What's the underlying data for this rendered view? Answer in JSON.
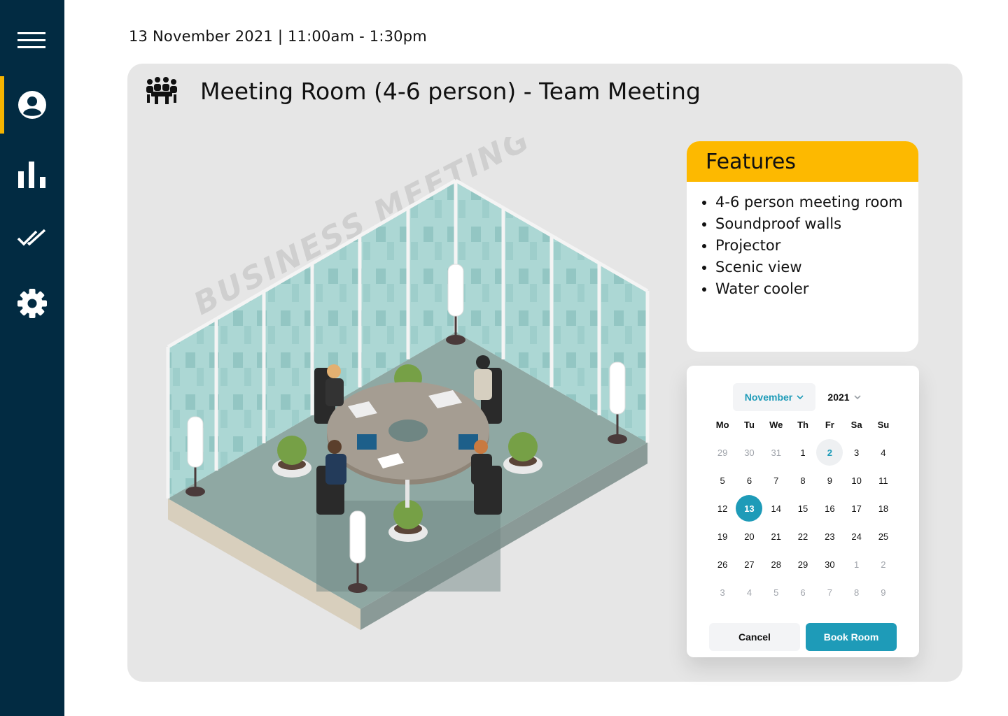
{
  "header": {
    "datetime": "13 November 2021 | 11:00am - 1:30pm"
  },
  "sidebar": {
    "items": [
      {
        "icon": "menu-icon"
      },
      {
        "icon": "user-circle-icon",
        "active": true
      },
      {
        "icon": "bar-chart-icon"
      },
      {
        "icon": "double-check-icon"
      },
      {
        "icon": "gear-icon"
      }
    ],
    "accent_color": "#f5b400",
    "background_color": "#022b42"
  },
  "room": {
    "icon": "meeting-group-icon",
    "title": "Meeting Room (4-6 person) - Team Meeting",
    "illustration_watermark": "BUSINESS MEETING"
  },
  "features": {
    "heading": "Features",
    "items": [
      "4-6 person meeting room",
      "Soundproof walls",
      "Projector",
      "Scenic view",
      "Water cooler"
    ],
    "accent_color": "#fdb900"
  },
  "calendar": {
    "month": "November",
    "year": "2021",
    "weekdays": [
      "Mo",
      "Tu",
      "We",
      "Th",
      "Fr",
      "Sa",
      "Su"
    ],
    "days": [
      {
        "d": "29",
        "m": true
      },
      {
        "d": "30",
        "m": true
      },
      {
        "d": "31",
        "m": true
      },
      {
        "d": "1"
      },
      {
        "d": "2",
        "today": true
      },
      {
        "d": "3"
      },
      {
        "d": "4"
      },
      {
        "d": "5"
      },
      {
        "d": "6"
      },
      {
        "d": "7"
      },
      {
        "d": "8"
      },
      {
        "d": "9"
      },
      {
        "d": "10"
      },
      {
        "d": "11"
      },
      {
        "d": "12"
      },
      {
        "d": "13",
        "selected": true
      },
      {
        "d": "14"
      },
      {
        "d": "15"
      },
      {
        "d": "16"
      },
      {
        "d": "17"
      },
      {
        "d": "18"
      },
      {
        "d": "19"
      },
      {
        "d": "20"
      },
      {
        "d": "21"
      },
      {
        "d": "22"
      },
      {
        "d": "23"
      },
      {
        "d": "24"
      },
      {
        "d": "25"
      },
      {
        "d": "26"
      },
      {
        "d": "27"
      },
      {
        "d": "28"
      },
      {
        "d": "29"
      },
      {
        "d": "30"
      },
      {
        "d": "1",
        "m": true
      },
      {
        "d": "2",
        "m": true
      },
      {
        "d": "3",
        "m": true
      },
      {
        "d": "4",
        "m": true
      },
      {
        "d": "5",
        "m": true
      },
      {
        "d": "6",
        "m": true
      },
      {
        "d": "7",
        "m": true
      },
      {
        "d": "8",
        "m": true
      },
      {
        "d": "9",
        "m": true
      }
    ],
    "cancel_label": "Cancel",
    "book_label": "Book Room",
    "accent_color": "#1e9bb8"
  }
}
